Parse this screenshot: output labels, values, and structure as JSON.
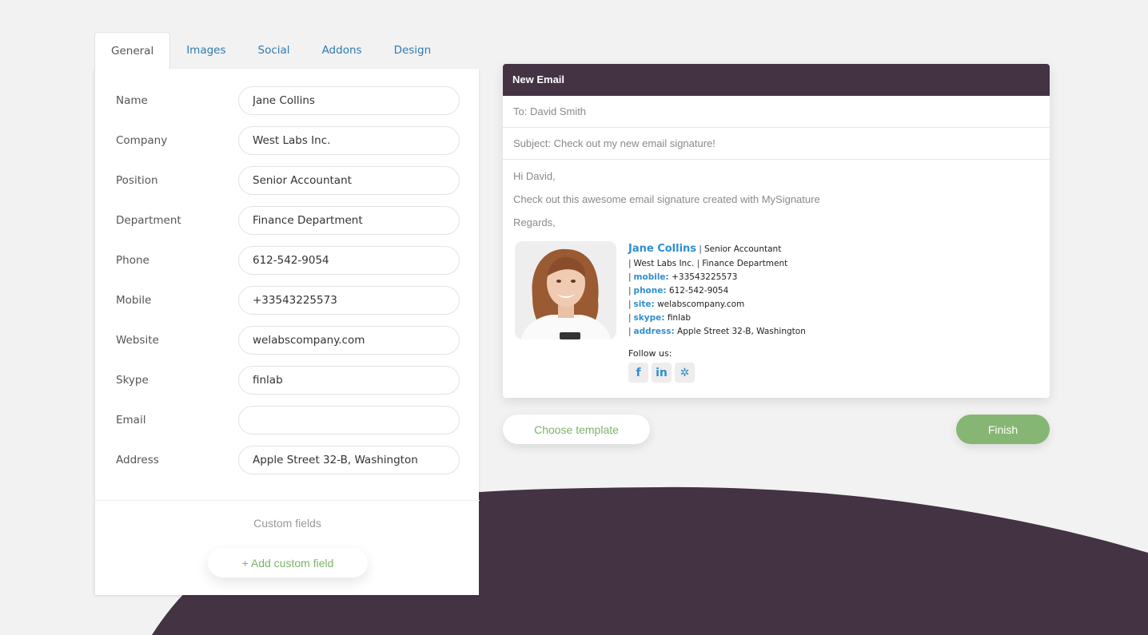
{
  "colors": {
    "accent_dark": "#433343",
    "link_blue": "#2f7ab3",
    "signature_blue": "#2f8fd0",
    "green": "#86b673",
    "background": "#f2f2f2"
  },
  "tabs": [
    {
      "label": "General",
      "active": true
    },
    {
      "label": "Images",
      "active": false
    },
    {
      "label": "Social",
      "active": false
    },
    {
      "label": "Addons",
      "active": false
    },
    {
      "label": "Design",
      "active": false
    }
  ],
  "form": {
    "fields": [
      {
        "label": "Name",
        "value": "Jane Collins"
      },
      {
        "label": "Company",
        "value": "West Labs Inc."
      },
      {
        "label": "Position",
        "value": "Senior Accountant"
      },
      {
        "label": "Department",
        "value": "Finance Department"
      },
      {
        "label": "Phone",
        "value": "612-542-9054"
      },
      {
        "label": "Mobile",
        "value": "+33543225573"
      },
      {
        "label": "Website",
        "value": "welabscompany.com"
      },
      {
        "label": "Skype",
        "value": "finlab"
      },
      {
        "label": "Email",
        "value": ""
      },
      {
        "label": "Address",
        "value": "Apple Street 32-B, Washington"
      }
    ],
    "custom_fields_label": "Custom fields",
    "add_custom_field_label": "+ Add custom field"
  },
  "email": {
    "header": "New Email",
    "to": "To: David Smith",
    "subject": "Subject: Check out my new email signature!",
    "body": [
      "Hi David,",
      "Check out this awesome email signature created with MySignature",
      "Regards,"
    ]
  },
  "signature": {
    "name": "Jane Collins",
    "position": "Senior Accountant",
    "company": "West Labs Inc.",
    "department": "Finance Department",
    "separator": "|",
    "details": [
      {
        "key": "mobile:",
        "value": "+33543225573"
      },
      {
        "key": "phone:",
        "value": "612-542-9054"
      },
      {
        "key": "site:",
        "value": "welabscompany.com"
      },
      {
        "key": "skype:",
        "value": "finlab"
      },
      {
        "key": "address:",
        "value": "Apple Street 32-B, Washington"
      }
    ],
    "follow_label": "Follow us:",
    "socials": [
      {
        "icon": "facebook-icon",
        "glyph": "f"
      },
      {
        "icon": "linkedin-icon",
        "glyph": "in"
      },
      {
        "icon": "gear-social-icon",
        "glyph": "✲"
      }
    ]
  },
  "actions": {
    "choose_template_label": "Choose template",
    "finish_label": "Finish"
  }
}
